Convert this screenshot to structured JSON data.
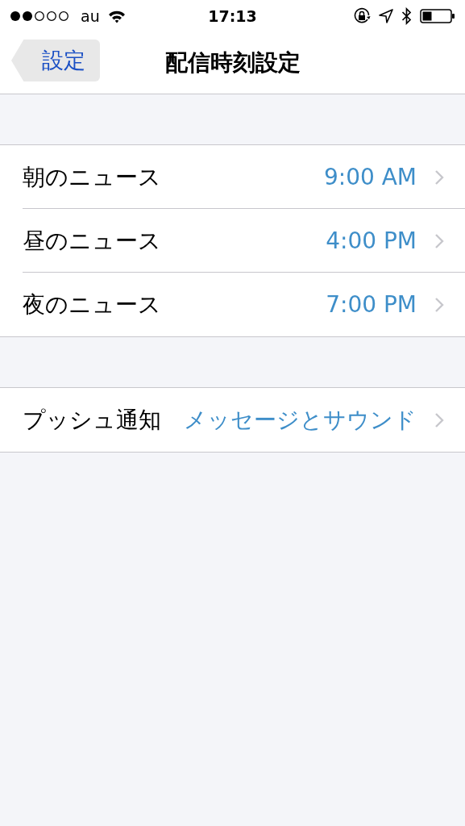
{
  "status_bar": {
    "carrier": "au",
    "time": "17:13"
  },
  "nav": {
    "back": "設定",
    "title": "配信時刻設定"
  },
  "sections": [
    {
      "rows": [
        {
          "label": "朝のニュース",
          "value": "9:00 AM"
        },
        {
          "label": "昼のニュース",
          "value": "4:00 PM"
        },
        {
          "label": "夜のニュース",
          "value": "7:00 PM"
        }
      ]
    },
    {
      "rows": [
        {
          "label": "プッシュ通知",
          "value": "メッセージとサウンド"
        }
      ]
    }
  ]
}
